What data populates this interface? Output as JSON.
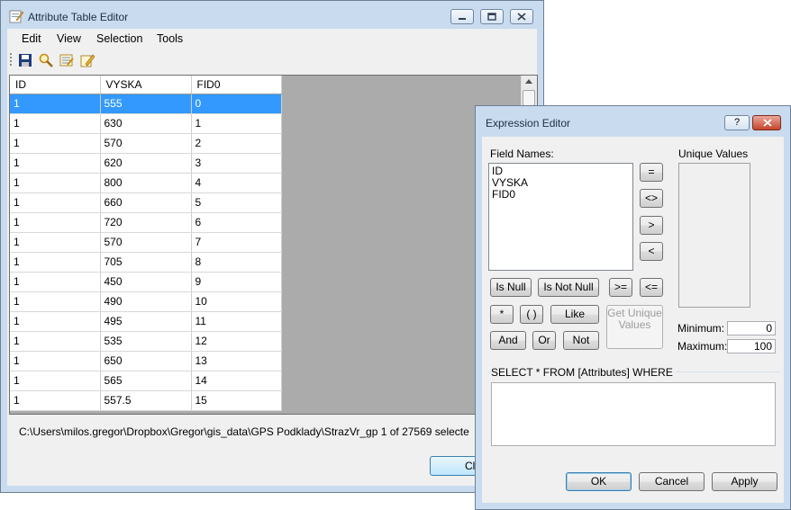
{
  "main_window": {
    "title": "Attribute Table Editor",
    "menu": [
      "Edit",
      "View",
      "Selection",
      "Tools"
    ],
    "toolbar_icons": [
      "save-icon",
      "search-icon",
      "table-icon",
      "edit-icon"
    ],
    "table": {
      "columns": [
        "ID",
        "VYSKA",
        "FID0"
      ],
      "selected_row": 0,
      "rows": [
        [
          "1",
          "555",
          "0"
        ],
        [
          "1",
          "630",
          "1"
        ],
        [
          "1",
          "570",
          "2"
        ],
        [
          "1",
          "620",
          "3"
        ],
        [
          "1",
          "800",
          "4"
        ],
        [
          "1",
          "660",
          "5"
        ],
        [
          "1",
          "720",
          "6"
        ],
        [
          "1",
          "570",
          "7"
        ],
        [
          "1",
          "705",
          "8"
        ],
        [
          "1",
          "450",
          "9"
        ],
        [
          "1",
          "490",
          "10"
        ],
        [
          "1",
          "495",
          "11"
        ],
        [
          "1",
          "535",
          "12"
        ],
        [
          "1",
          "650",
          "13"
        ],
        [
          "1",
          "565",
          "14"
        ],
        [
          "1",
          "557.5",
          "15"
        ]
      ]
    },
    "status_text": "C:\\Users\\milos.gregor\\Dropbox\\Gregor\\gis_data\\GPS Podklady\\StrazVr_gp 1 of 27569 selecte",
    "close_label": "Cl"
  },
  "expression_editor": {
    "title": "Expression Editor",
    "help_label": "?",
    "field_names_label": "Field Names:",
    "field_names": [
      "ID",
      "VYSKA",
      "FID0"
    ],
    "unique_values_label": "Unique Values",
    "operators": {
      "eq": "=",
      "neq": "<>",
      "gt": ">",
      "lt": "<",
      "is_null": "Is Null",
      "is_not_null": "Is Not Null",
      "gte": ">=",
      "lte": "<=",
      "star": "*",
      "parens": "( )",
      "like": "Like",
      "and": "And",
      "or": "Or",
      "not": "Not"
    },
    "get_unique_values_label": "Get Unique Values",
    "minimum_label": "Minimum:",
    "minimum_value": "0",
    "maximum_label": "Maximum:",
    "maximum_value": "100",
    "sql_label": "SELECT * FROM [Attributes] WHERE",
    "sql_text": "",
    "ok_label": "OK",
    "cancel_label": "Cancel",
    "apply_label": "Apply"
  }
}
